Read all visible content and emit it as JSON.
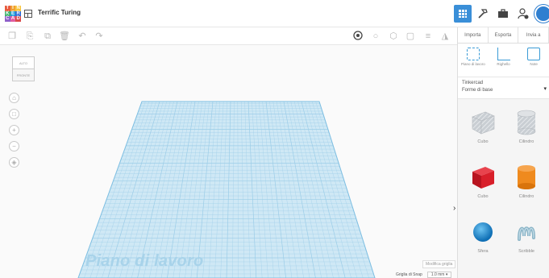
{
  "header": {
    "logo_letters": [
      "T",
      "I",
      "N",
      "K",
      "E",
      "R",
      "C",
      "A",
      "D"
    ],
    "logo_colors": [
      "#e85a3c",
      "#f0a030",
      "#f7c53c",
      "#3fb46e",
      "#1f9dd9",
      "#2e6bd6",
      "#8f5fc9",
      "#e05da0",
      "#d94a4a"
    ],
    "project_title": "Terrific Turing",
    "icons": [
      "grid-view-icon",
      "hammer-icon",
      "briefcase-icon",
      "user-add-icon",
      "avatar"
    ]
  },
  "toolbar": {
    "icons": [
      "copy-icon",
      "paste-icon",
      "duplicate-icon",
      "delete-icon",
      "undo-icon",
      "redo-icon",
      "note-icon",
      "light-bulb-icon",
      "shape-icon",
      "hole-icon",
      "align-icon",
      "mirror-icon"
    ]
  },
  "panel": {
    "tabs": [
      "Importa",
      "Esporta",
      "Invia a"
    ],
    "tools": [
      {
        "label": "Piano di lavoro",
        "icon": "workplane-icon"
      },
      {
        "label": "Righello",
        "icon": "ruler-icon"
      },
      {
        "label": "Note",
        "icon": "note-icon"
      }
    ],
    "library_title": "Tinkercad",
    "library_value": "Forme di base",
    "shapes": [
      {
        "label": "Cubo",
        "kind": "hole-cube"
      },
      {
        "label": "Cilindro",
        "kind": "hole-cylinder"
      },
      {
        "label": "Cubo",
        "kind": "cube"
      },
      {
        "label": "Cilindro",
        "kind": "cylinder"
      },
      {
        "label": "Sfera",
        "kind": "sphere"
      },
      {
        "label": "Scribble",
        "kind": "scribble"
      }
    ]
  },
  "canvas": {
    "viewcube_top": "ALTO",
    "viewcube_front": "FRONTE",
    "workplane_label": "Piano di lavoro",
    "edit_grid_label": "Modifica griglia",
    "snap_label": "Griglia di Snap",
    "snap_value": "1.0 mm"
  },
  "colors": {
    "accent": "#3a8fd8",
    "workplane": "#cfe8f5",
    "grid_line": "#9ccde8",
    "cube_red": "#d81f2a",
    "cylinder_orange": "#ef8a1e",
    "sphere_blue": "#1f8fd8",
    "scribble_teal": "#8ab4c7"
  }
}
